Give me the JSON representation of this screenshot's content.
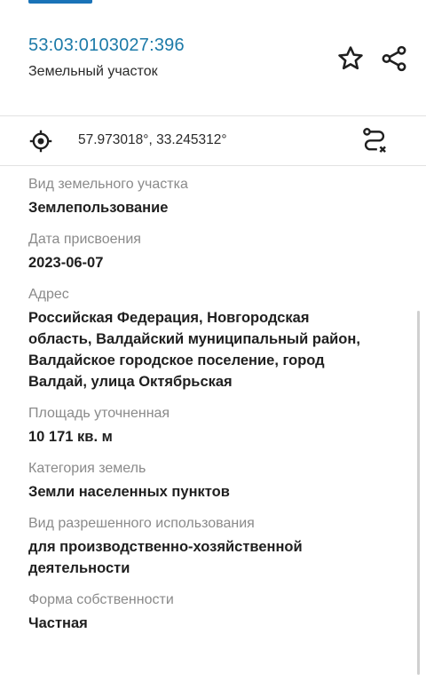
{
  "header": {
    "cadastral_number": "53:03:0103027:396",
    "object_type": "Земельный участок"
  },
  "actions": {
    "favorite_icon": "star-outline-icon",
    "share_icon": "share-icon"
  },
  "location": {
    "coordinates": "57.973018°, 33.245312°",
    "locate_icon": "crosshair-icon",
    "route_icon": "route-icon"
  },
  "fields": [
    {
      "label": "Вид земельного участка",
      "value": "Землепользование"
    },
    {
      "label": "Дата присвоения",
      "value": "2023-06-07"
    },
    {
      "label": "Адрес",
      "value": "Российская Федерация, Новгородская область, Валдайский муниципальный район, Валдайское городское поселение, город Валдай, улица Октябрьская"
    },
    {
      "label": "Площадь уточненная",
      "value": "10 171 кв. м"
    },
    {
      "label": "Категория земель",
      "value": "Земли населенных пунктов"
    },
    {
      "label": "Вид разрешенного использования",
      "value": "для производственно-хозяйственной деятельности"
    },
    {
      "label": "Форма собственности",
      "value": "Частная"
    }
  ],
  "colors": {
    "accent": "#1a73b8",
    "cadastral_link": "#1c7aa8",
    "label_gray": "#8a8a8a",
    "divider": "#e2e2e2"
  }
}
